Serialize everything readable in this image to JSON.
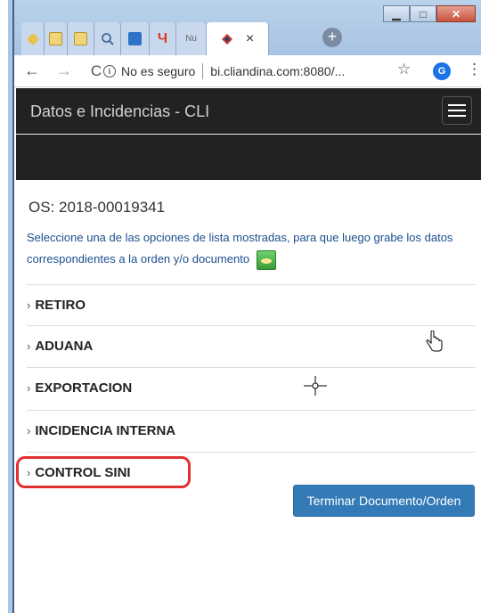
{
  "browser": {
    "tabs": [
      {
        "name": "tab-1",
        "color": "#e9c14b"
      },
      {
        "name": "tab-2",
        "color": "#f0d47a"
      },
      {
        "name": "tab-3",
        "color": "#f0d47a"
      },
      {
        "name": "tab-4",
        "color": "#9bb7d8"
      },
      {
        "name": "tab-5",
        "color": "#2c73c9"
      },
      {
        "name": "tab-6",
        "color": "#e23b2e"
      },
      {
        "name": "tab-7",
        "label": "Nu",
        "color": "#b8c8de"
      }
    ],
    "active_tab_icon_color": "#c0392b",
    "tab_close": "×",
    "new_tab": "+",
    "security_text": "No es seguro",
    "url": "bi.cliandina.com:8080/...",
    "profile_initial": "G"
  },
  "navbar": {
    "brand": "Datos e Incidencias - CLI"
  },
  "page": {
    "os_title": "OS: 2018-00019341",
    "instructions": "Seleccione una de las opciones de lista mostradas, para que luego grabe los datos correspondientes a la orden y/o documento",
    "sections": [
      {
        "label": "RETIRO"
      },
      {
        "label": "ADUANA"
      },
      {
        "label": "EXPORTACION"
      },
      {
        "label": "INCIDENCIA INTERNA"
      },
      {
        "label": "CONTROL SINI"
      }
    ],
    "finish_button": "Terminar Documento/Orden"
  },
  "colors": {
    "navbar_bg": "#222222",
    "link_text": "#1c4f8f",
    "primary_button": "#337ab7",
    "highlight_circle": "#e03030"
  }
}
